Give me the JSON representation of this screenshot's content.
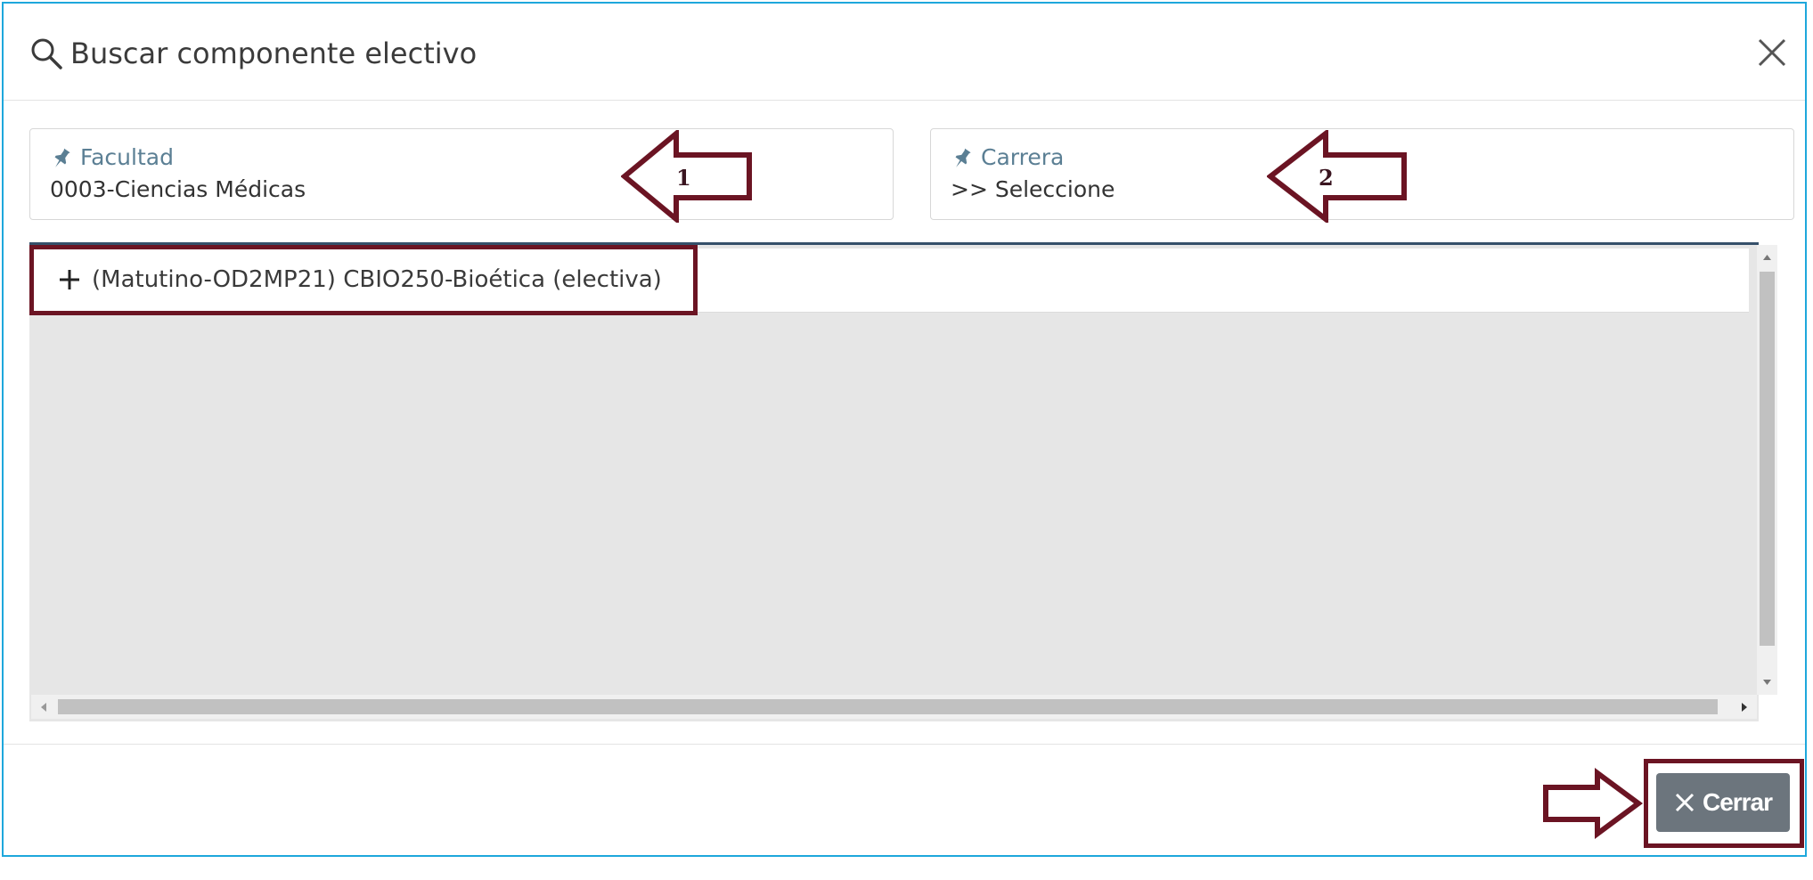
{
  "modal": {
    "title": "Buscar componente electivo",
    "search_icon": "search-icon",
    "close_icon": "close-icon"
  },
  "fields": {
    "facultad": {
      "label": "Facultad",
      "value": "0003-Ciencias Médicas",
      "icon": "pin-icon"
    },
    "carrera": {
      "label": "Carrera",
      "value": ">> Seleccione",
      "icon": "pin-icon"
    }
  },
  "annotations": {
    "arrow1_label": "1",
    "arrow2_label": "2",
    "color": "#6b1423"
  },
  "list": {
    "items": [
      {
        "icon": "plus-icon",
        "text": "(Matutino-OD2MP21) CBIO250-Bioética (electiva)"
      }
    ]
  },
  "footer": {
    "close_button": "Cerrar",
    "close_button_icon": "x-icon"
  },
  "colors": {
    "accent_border": "#1ea7dc",
    "label_color": "#5b7f94",
    "button_bg": "#6c757d",
    "panel_top_border": "#35506a"
  }
}
